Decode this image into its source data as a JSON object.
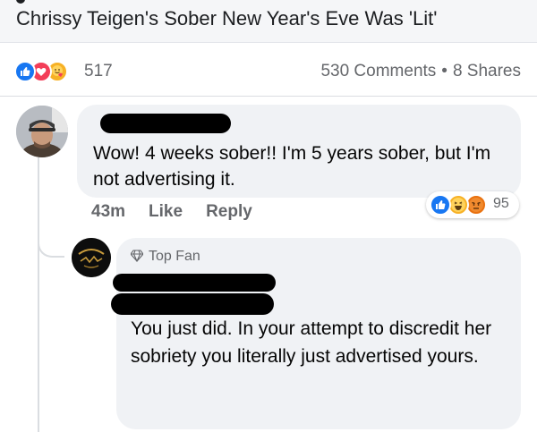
{
  "post": {
    "title": "Chrissy Teigen's Sober New Year's Eve Was 'Lit'"
  },
  "reactions": {
    "icons": [
      "like-icon",
      "love-icon",
      "care-icon"
    ],
    "count": "517",
    "comments": "530 Comments",
    "separator": "•",
    "shares": "8 Shares"
  },
  "comment1": {
    "author_redacted": true,
    "text": "Wow! 4 weeks sober!! I'm  5 years sober, but I'm not advertising it.",
    "time": "43m",
    "like_label": "Like",
    "reply_label": "Reply",
    "reaction_icons": [
      "like-icon",
      "haha-icon",
      "angry-icon"
    ],
    "reaction_count": "95"
  },
  "reply1": {
    "badge": "Top Fan",
    "author_redacted": true,
    "text": "You just did.  In your attempt to discredit her sobriety you literally just advertised yours."
  },
  "colors": {
    "like_blue": "#1877f2",
    "love_red": "#f33e58",
    "care_yellow": "#f7b125",
    "angry_orange": "#e9710f",
    "bubble_gray": "#f0f2f5",
    "meta_gray": "#65676b"
  }
}
